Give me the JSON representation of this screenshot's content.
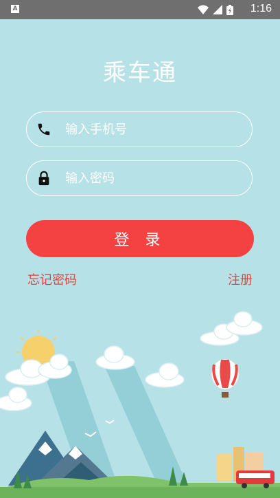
{
  "status_bar": {
    "time": "1:16",
    "app_badge": "A"
  },
  "app": {
    "title": "乘车通"
  },
  "login_form": {
    "phone_placeholder": "输入手机号",
    "password_placeholder": "输入密码",
    "login_label": "登 录",
    "forgot_label": "忘记密码",
    "register_label": "注册"
  },
  "colors": {
    "background": "#b6e1e6",
    "primary": "#f44141",
    "link": "#e8413f"
  },
  "icons": [
    "phone-icon",
    "lock-icon",
    "wifi-icon",
    "signal-icon",
    "battery-icon"
  ]
}
